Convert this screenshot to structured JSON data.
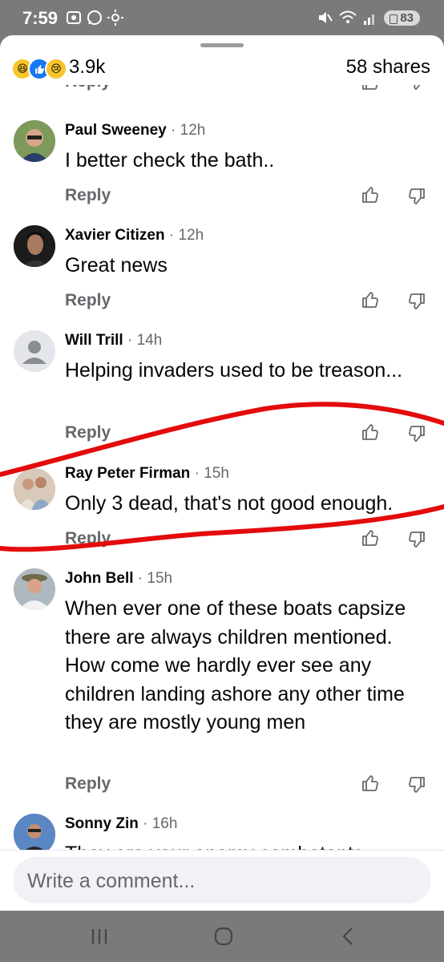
{
  "status": {
    "time": "7:59",
    "battery": "83"
  },
  "post": {
    "reaction_count": "3.9k",
    "shares": "58 shares",
    "reaction_icons": [
      "haha-reaction-icon",
      "like-reaction-icon",
      "sad-reaction-icon"
    ]
  },
  "prev_reply_label": "Reply",
  "comments": [
    {
      "name": "Paul Sweeney",
      "time": "12h",
      "text": "I better check the bath..",
      "reply": "Reply"
    },
    {
      "name": "Xavier Citizen",
      "time": "12h",
      "text": "Great news",
      "reply": "Reply"
    },
    {
      "name": "Will Trill",
      "time": "14h",
      "text": "Helping invaders used to be treason...",
      "reply": "Reply"
    },
    {
      "name": "Ray Peter Firman",
      "time": "15h",
      "text": "Only 3 dead, that's not good enough.",
      "reply": "Reply"
    },
    {
      "name": "John Bell",
      "time": "15h",
      "text": "When ever one of these boats capsize there are always children mentioned. How come we hardly ever see any children landing ashore any other time they are mostly young men",
      "reply": "Reply"
    },
    {
      "name": "Sonny Zin",
      "time": "16h",
      "text": "They are your enemy combatants",
      "reply": ""
    }
  ],
  "composer": {
    "placeholder": "Write a comment..."
  },
  "colors": {
    "text_primary": "#050505",
    "text_secondary": "#65676b",
    "annotation": "#e30b0b",
    "like_blue": "#1877f2"
  }
}
